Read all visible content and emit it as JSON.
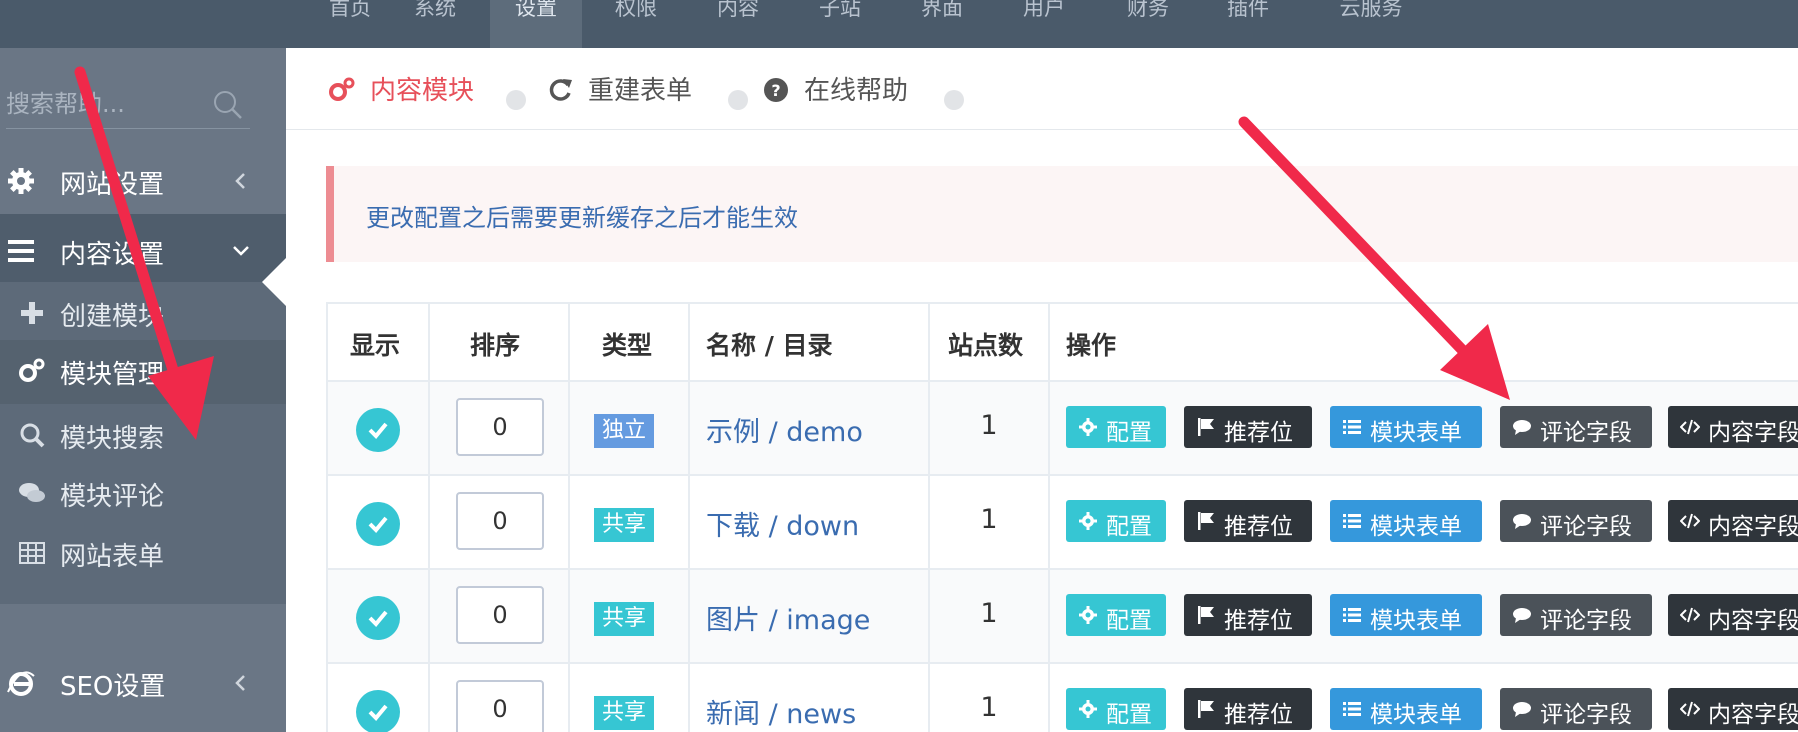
{
  "topnav": {
    "tabs": [
      {
        "label": "首页"
      },
      {
        "label": "系统"
      },
      {
        "label": "设置",
        "active": true
      },
      {
        "label": "权限"
      },
      {
        "label": "内容"
      },
      {
        "label": "子站"
      },
      {
        "label": "界面"
      },
      {
        "label": "用户"
      },
      {
        "label": "财务"
      },
      {
        "label": "插件"
      },
      {
        "label": "云服务"
      }
    ]
  },
  "sidebar": {
    "search_placeholder": "搜索帮助...",
    "items": [
      {
        "label": "网站设置",
        "icon": "gear-icon",
        "expanded": false
      },
      {
        "label": "内容设置",
        "icon": "menu-icon",
        "expanded": true
      },
      {
        "label": "SEO设置",
        "icon": "ie-icon",
        "expanded": false
      }
    ],
    "subitems": [
      {
        "label": "创建模块",
        "icon": "plus-icon"
      },
      {
        "label": "模块管理",
        "icon": "cogs-icon",
        "current": true
      },
      {
        "label": "模块搜索",
        "icon": "search-icon"
      },
      {
        "label": "模块评论",
        "icon": "comments-icon"
      },
      {
        "label": "网站表单",
        "icon": "table-icon"
      }
    ]
  },
  "subnav": {
    "tabs": [
      {
        "label": "内容模块",
        "icon": "cogs-icon",
        "active": true
      },
      {
        "label": "重建表单",
        "icon": "refresh-icon"
      },
      {
        "label": "在线帮助",
        "icon": "question-icon"
      }
    ]
  },
  "alert": {
    "text": "更改配置之后需要更新缓存之后才能生效"
  },
  "table": {
    "headers": [
      "显示",
      "排序",
      "类型",
      "名称 / 目录",
      "站点数",
      "操作"
    ],
    "rows": [
      {
        "shown": true,
        "order": "0",
        "type": "独立",
        "name": "示例 / demo",
        "sites": "1"
      },
      {
        "shown": true,
        "order": "0",
        "type": "共享",
        "name": "下载 / down",
        "sites": "1"
      },
      {
        "shown": true,
        "order": "0",
        "type": "共享",
        "name": "图片 / image",
        "sites": "1"
      },
      {
        "shown": true,
        "order": "0",
        "type": "共享",
        "name": "新闻 / news",
        "sites": "1"
      }
    ],
    "actions": {
      "config": "配置",
      "flag": "推荐位",
      "form": "模块表单",
      "comment": "评论字段",
      "code": "内容字段"
    }
  },
  "colors": {
    "topbar": "#4a5a6a",
    "sidebar": "#6a7685",
    "accent_red": "#e7505a",
    "badge_independent": "#659be0",
    "badge_shared": "#36c6d3",
    "arrow": "#f0294a"
  }
}
